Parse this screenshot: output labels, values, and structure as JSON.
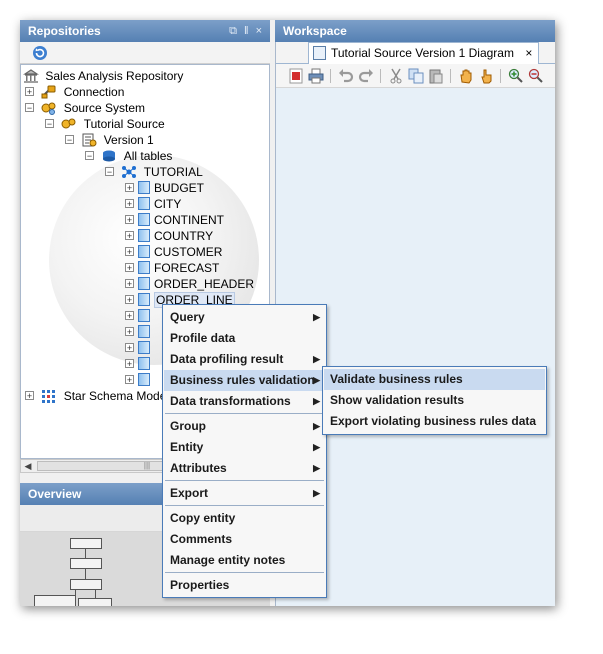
{
  "repositories_panel": {
    "title": "Repositories",
    "controls": "⧉ ‖ ×"
  },
  "tree": {
    "root": "Sales Analysis Repository",
    "connection": "Connection",
    "source_system": "Source System",
    "tutorial_source": "Tutorial Source",
    "version": "Version 1",
    "all_tables": "All tables",
    "schema": "TUTORIAL",
    "tables": [
      "BUDGET",
      "CITY",
      "CONTINENT",
      "COUNTRY",
      "CUSTOMER",
      "FORECAST",
      "ORDER_HEADER",
      "ORDER_LINE"
    ],
    "star_schema": "Star Schema Mode"
  },
  "overview_panel": {
    "title": "Overview"
  },
  "workspace_panel": {
    "title": "Workspace",
    "tab_label": "Tutorial Source Version 1 Diagram",
    "tab_close": "×"
  },
  "context_menu": {
    "items": [
      {
        "label": "Query",
        "submenu": true
      },
      {
        "label": "Profile data",
        "submenu": false
      },
      {
        "label": "Data profiling result",
        "submenu": true
      },
      {
        "label": "Business rules validation",
        "submenu": true
      },
      {
        "label": "Data transformations",
        "submenu": true
      },
      {
        "label": "Group",
        "submenu": true
      },
      {
        "label": "Entity",
        "submenu": true
      },
      {
        "label": "Attributes",
        "submenu": true
      },
      {
        "label": "Export",
        "submenu": true
      },
      {
        "label": "Copy entity",
        "submenu": false
      },
      {
        "label": "Comments",
        "submenu": false
      },
      {
        "label": "Manage entity notes",
        "submenu": false
      },
      {
        "label": "Properties",
        "submenu": false
      }
    ],
    "highlighted": "Business rules validation"
  },
  "submenu": {
    "items": [
      "Validate business rules",
      "Show validation results",
      "Export violating business rules data"
    ],
    "highlighted": "Validate business rules"
  },
  "colors": {
    "title_bar": "#5580b3",
    "menu_highlight": "#c9daf0",
    "workspace_bg": "#e7f0f8"
  }
}
